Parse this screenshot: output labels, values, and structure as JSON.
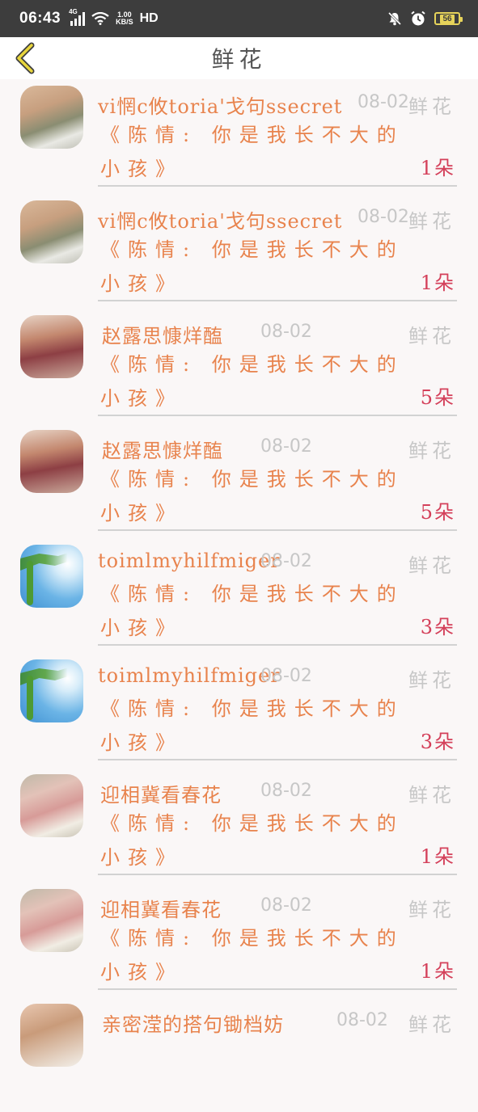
{
  "status": {
    "time": "06:43",
    "network": "4G",
    "speed": "1.00",
    "speed_unit": "KB/S",
    "hd": "HD",
    "battery": "56"
  },
  "nav": {
    "title": "鲜花"
  },
  "rows": [
    {
      "name": "vi惘c攸toria'戈句ssecret",
      "date": "08-02",
      "flower": "鲜花",
      "work": "《陈情: 你是我长不大的小孩》",
      "count": "1朵",
      "avatar": "baby"
    },
    {
      "name": "vi惘c攸toria'戈句ssecret",
      "date": "08-02",
      "flower": "鲜花",
      "work": "《陈情: 你是我长不大的小孩》",
      "count": "1朵",
      "avatar": "baby"
    },
    {
      "name": "赵露思慷烊醢",
      "date": "08-02",
      "flower": "鲜花",
      "work": "《陈情: 你是我长不大的小孩》",
      "count": "5朵",
      "avatar": "woman"
    },
    {
      "name": "赵露思慷烊醢",
      "date": "08-02",
      "flower": "鲜花",
      "work": "《陈情: 你是我长不大的小孩》",
      "count": "5朵",
      "avatar": "woman"
    },
    {
      "name": "toimlmyhilfmiger",
      "date": "08-02",
      "flower": "鲜花",
      "work": "《陈情: 你是我长不大的小孩》",
      "count": "3朵",
      "avatar": "sky"
    },
    {
      "name": "toimlmyhilfmiger",
      "date": "08-02",
      "flower": "鲜花",
      "work": "《陈情: 你是我长不大的小孩》",
      "count": "3朵",
      "avatar": "sky"
    },
    {
      "name": "迎相冀看春花",
      "date": "08-02",
      "flower": "鲜花",
      "work": "《陈情: 你是我长不大的小孩》",
      "count": "1朵",
      "avatar": "anime"
    },
    {
      "name": "迎相冀看春花",
      "date": "08-02",
      "flower": "鲜花",
      "work": "《陈情: 你是我长不大的小孩》",
      "count": "1朵",
      "avatar": "anime"
    },
    {
      "name": "亲密滢的搭句锄档妨",
      "date": "08-02",
      "flower": "鲜花",
      "work": "",
      "count": "",
      "avatar": "boy"
    }
  ]
}
